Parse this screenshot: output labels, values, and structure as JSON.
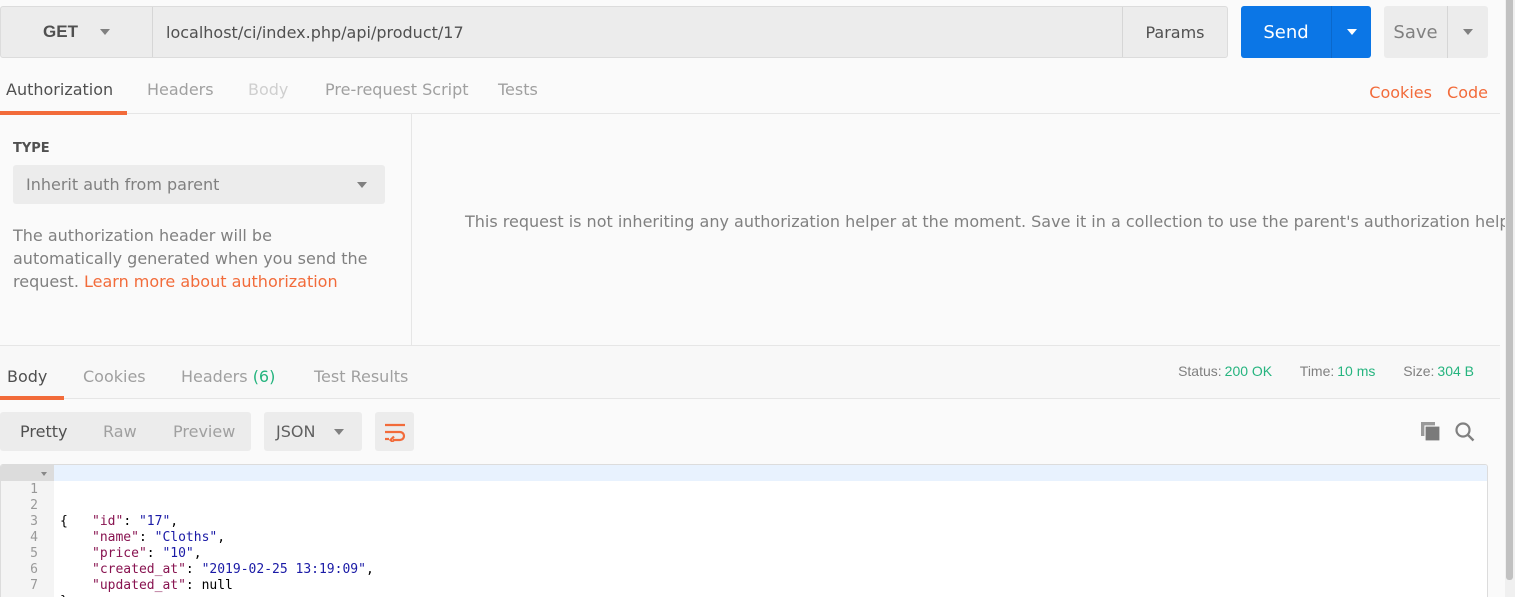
{
  "request": {
    "method": "GET",
    "url": "localhost/ci/index.php/api/product/17",
    "params_label": "Params",
    "send_label": "Send",
    "save_label": "Save"
  },
  "request_tabs": [
    {
      "label": "Authorization",
      "state": "active"
    },
    {
      "label": "Headers",
      "state": "normal"
    },
    {
      "label": "Body",
      "state": "disabled"
    },
    {
      "label": "Pre-request Script",
      "state": "normal"
    },
    {
      "label": "Tests",
      "state": "normal"
    }
  ],
  "request_links": {
    "cookies": "Cookies",
    "code": "Code"
  },
  "auth": {
    "type_label": "TYPE",
    "type_value": "Inherit auth from parent",
    "description": "The authorization header will be automatically generated when you send the request. ",
    "learn_more": "Learn more about authorization",
    "message": "This request is not inheriting any authorization helper at the moment. Save it in a collection to use the parent's authorization helper."
  },
  "response_tabs": [
    {
      "label": "Body",
      "state": "active"
    },
    {
      "label": "Cookies",
      "state": "normal"
    },
    {
      "label": "Headers",
      "count": "(6)",
      "state": "normal"
    },
    {
      "label": "Test Results",
      "state": "normal"
    }
  ],
  "response_meta": {
    "status_label": "Status:",
    "status_value": "200 OK",
    "time_label": "Time:",
    "time_value": "10 ms",
    "size_label": "Size:",
    "size_value": "304 B"
  },
  "view_modes": [
    "Pretty",
    "Raw",
    "Preview"
  ],
  "active_view": "Pretty",
  "format": "JSON",
  "icons": {
    "wrap": "wrap-lines-icon",
    "copy": "copy-icon",
    "search": "search-icon"
  },
  "colors": {
    "accent": "#f26b3a",
    "send": "#0b76e6",
    "success": "#26b47f",
    "json_key": "#881350",
    "json_string": "#1a1aa6"
  },
  "code_lines": [
    {
      "n": "1",
      "text": "{"
    },
    {
      "n": "2",
      "key": "\"id\"",
      "value": "\"17\"",
      "trail": ","
    },
    {
      "n": "3",
      "key": "\"name\"",
      "value": "\"Cloths\"",
      "trail": ","
    },
    {
      "n": "4",
      "key": "\"price\"",
      "value": "\"10\"",
      "trail": ","
    },
    {
      "n": "5",
      "key": "\"created_at\"",
      "value": "\"2019-02-25 13:19:09\"",
      "trail": ","
    },
    {
      "n": "6",
      "key": "\"updated_at\"",
      "value": "null",
      "trail": ""
    },
    {
      "n": "7",
      "text": "}"
    }
  ]
}
